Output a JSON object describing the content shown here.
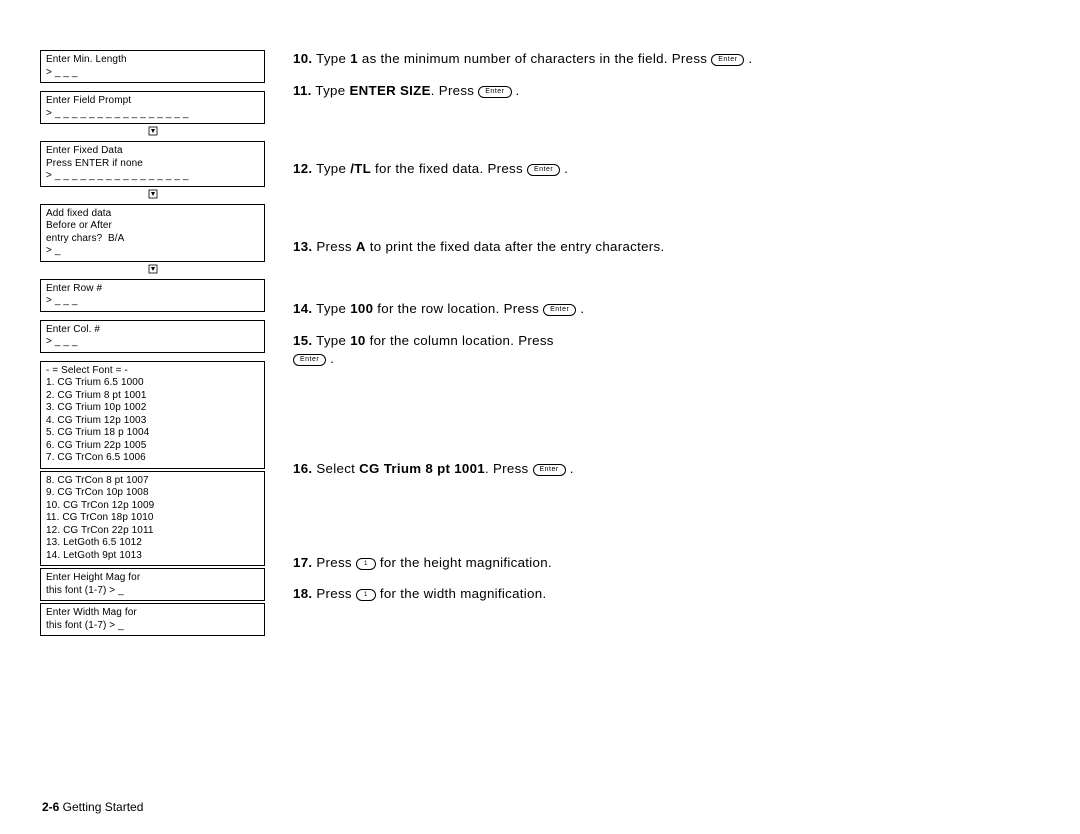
{
  "left": {
    "min_length": "Enter Min. Length\n> _ _ _",
    "field_prompt": "Enter Field Prompt\n> _ _ _ _ _ _ _ _ _ _ _ _ _ _ _ _",
    "fixed_data": "Enter Fixed Data\nPress ENTER if none\n> _ _ _ _ _ _ _ _ _ _ _ _ _ _ _ _",
    "add_fixed": "Add fixed data\nBefore or After\nentry chars?  B/A\n> _",
    "row": "Enter Row #\n> _ _ _",
    "col": "Enter Col. #\n> _ _ _",
    "fonts1": "- = Select Font = -\n1. CG Trium 6.5 1000\n2. CG Trium 8 pt 1001\n3. CG Trium 10p 1002\n4. CG Trium 12p 1003\n5. CG Trium 18 p 1004\n6. CG Trium 22p 1005\n7. CG TrCon 6.5 1006",
    "fonts2": "8. CG TrCon 8 pt 1007\n9. CG TrCon 10p 1008\n10. CG TrCon 12p 1009\n11. CG TrCon 18p 1010\n12. CG TrCon 22p 1011\n13. LetGoth 6.5 1012\n14. LetGoth 9pt 1013",
    "height_mag": "Enter Height Mag for\nthis font (1-7) > _",
    "width_mag": "Enter Width Mag for\nthis font (1-7) > _"
  },
  "steps": {
    "s10a": "Type ",
    "s10b": "1",
    "s10c": " as the minimum number of characters in the field.  Press ",
    "s11a": "Type ",
    "s11b": "ENTER SIZE",
    "s11c": ".  Press ",
    "s12a": "Type ",
    "s12b": "/TL",
    "s12c": " for the fixed data.  Press ",
    "s13a": "Press ",
    "s13b": "A",
    "s13c": " to print the fixed data after the entry characters.",
    "s14a": "Type ",
    "s14b": "100",
    "s14c": " for the row location.  Press ",
    "s15a": "Type ",
    "s15b": "10",
    "s15c": " for the column location.  Press ",
    "s16a": "Select ",
    "s16b": "CG Trium 8 pt 1001",
    "s16c": ".  Press ",
    "s17a": "Press ",
    "s17b": " for the height magnification.",
    "s18a": "Press ",
    "s18b": " for the width magnification."
  },
  "keys": {
    "enter": "Enter",
    "one": "1"
  },
  "nums": {
    "n10": "10.",
    "n11": "11.",
    "n12": "12.",
    "n13": "13.",
    "n14": "14.",
    "n15": "15.",
    "n16": "16.",
    "n17": "17.",
    "n18": "18."
  },
  "footer": {
    "page": "2-6",
    "title": "  Getting Started"
  },
  "period": " ."
}
